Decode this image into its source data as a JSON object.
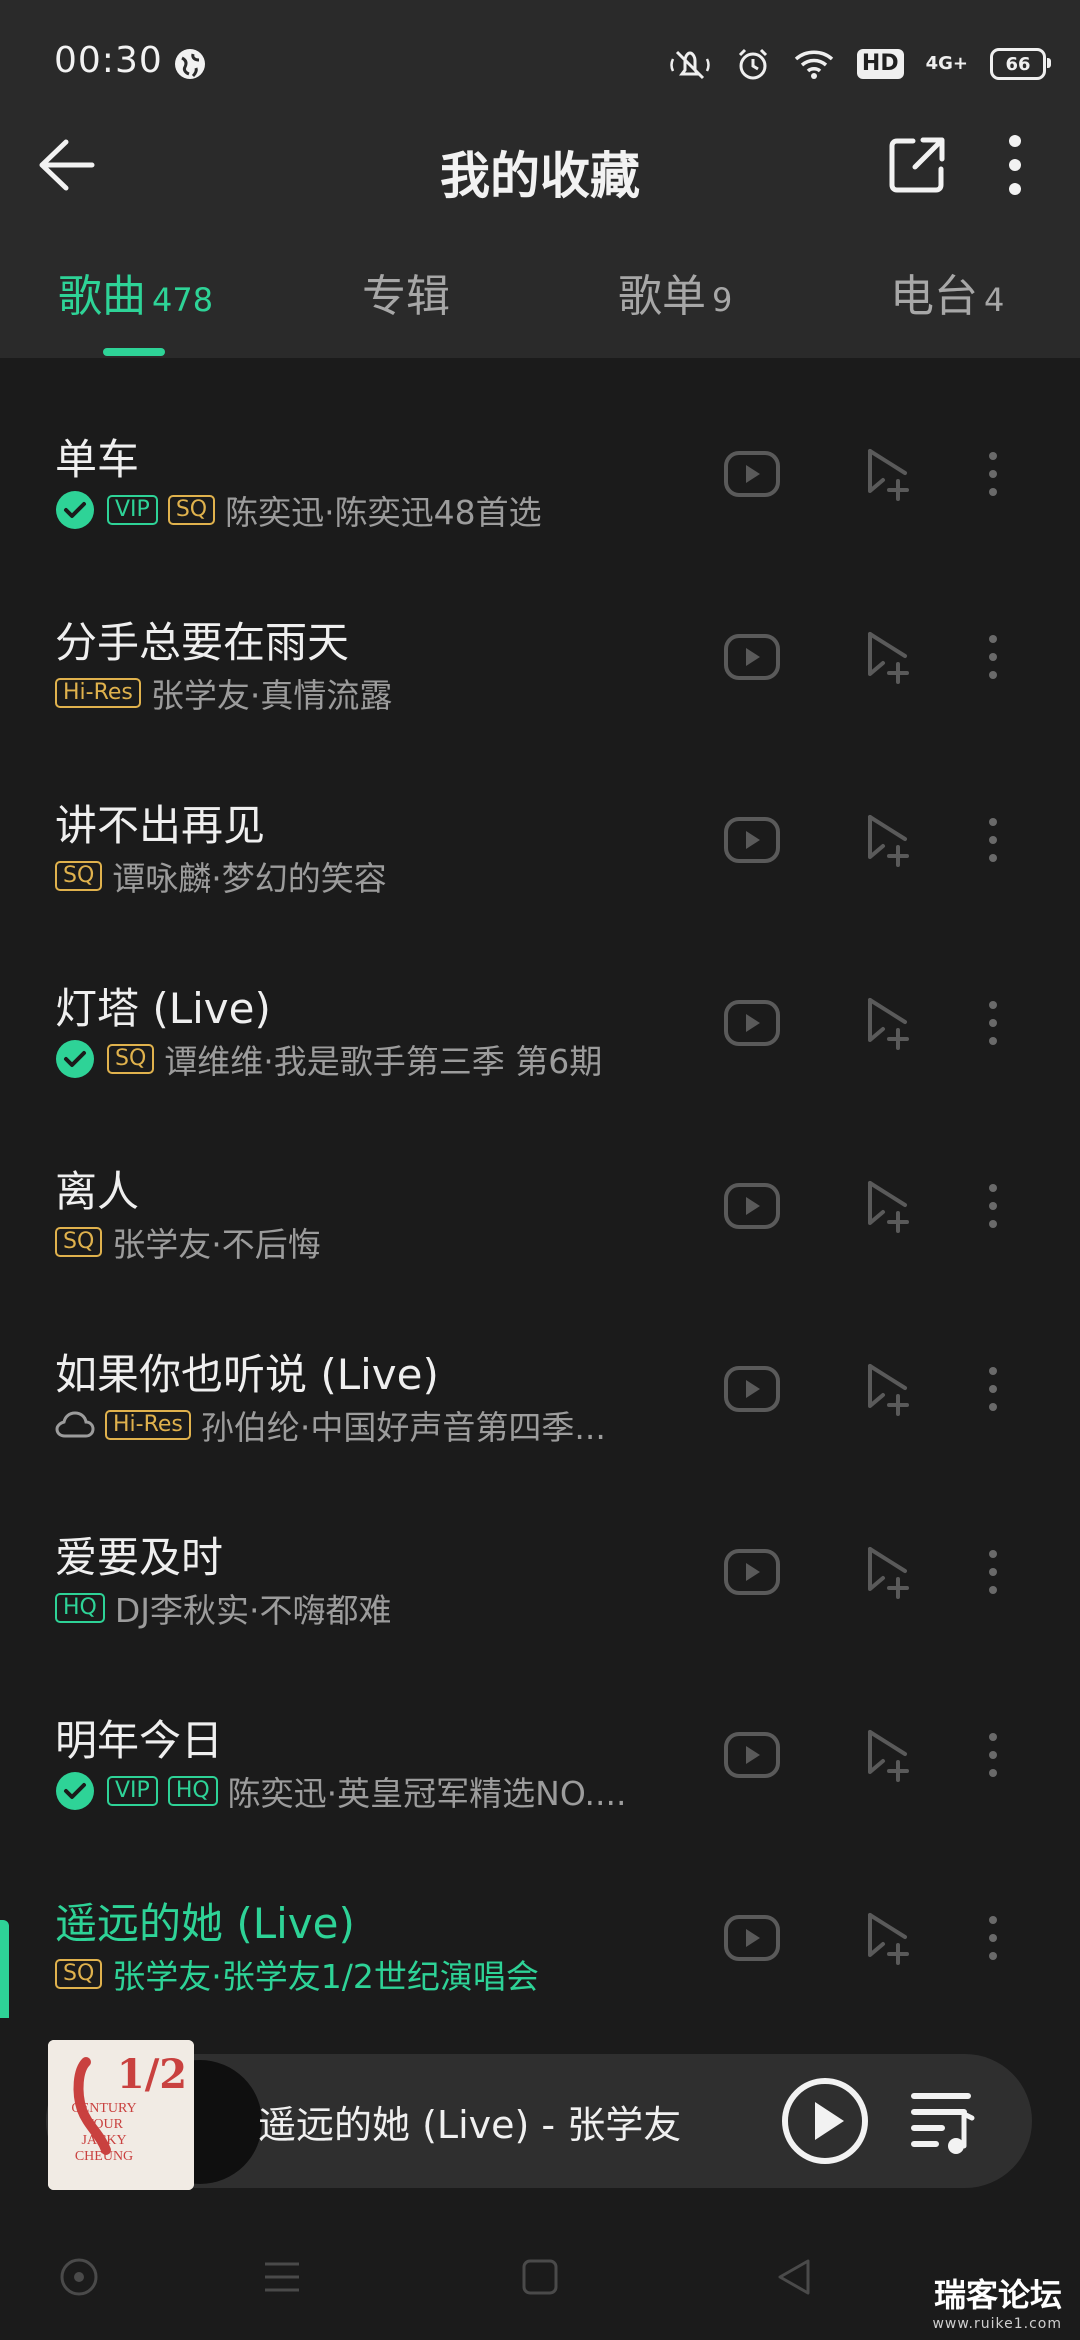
{
  "status_bar": {
    "time": "00:30",
    "hd": "HD",
    "network": "4G+",
    "battery": "66"
  },
  "header": {
    "title": "我的收藏"
  },
  "tabs": [
    {
      "label": "歌曲",
      "count": "478",
      "active": true
    },
    {
      "label": "专辑",
      "count": "",
      "active": false
    },
    {
      "label": "歌单",
      "count": "9",
      "active": false
    },
    {
      "label": "电台",
      "count": "4",
      "active": false
    }
  ],
  "songs": [
    {
      "title": "单车",
      "sub": "陈奕迅·陈奕迅48首选",
      "badges": [
        "VIP",
        "SQ"
      ],
      "downloaded": true
    },
    {
      "title": "分手总要在雨天",
      "sub": "张学友·真情流露",
      "badges": [
        "Hi-Res"
      ]
    },
    {
      "title": "讲不出再见",
      "sub": "谭咏麟·梦幻的笑容",
      "badges": [
        "SQ"
      ]
    },
    {
      "title": "灯塔 (Live)",
      "sub": "谭维维·我是歌手第三季 第6期",
      "badges": [
        "SQ"
      ],
      "downloaded": true
    },
    {
      "title": "离人",
      "sub": "张学友·不后悔",
      "badges": [
        "SQ"
      ]
    },
    {
      "title": "如果你也听说 (Live)",
      "sub": "孙伯纶·中国好声音第四季...",
      "badges": [
        "Hi-Res"
      ],
      "cloud": true
    },
    {
      "title": "爱要及时",
      "sub": "DJ李秋实·不嗨都难",
      "badges": [
        "HQ"
      ]
    },
    {
      "title": "明年今日",
      "sub": "陈奕迅·英皇冠军精选NO....",
      "badges": [
        "VIP",
        "HQ"
      ],
      "downloaded": true
    },
    {
      "title": "遥远的她 (Live)",
      "sub": "张学友·张学友1/2世纪演唱会",
      "badges": [
        "SQ"
      ],
      "playing": true
    }
  ],
  "now_playing": {
    "title": "遥远的她 (Live) - 张学友",
    "album_art_text": {
      "fraction": "1/2",
      "line1": "CENTURY",
      "line2": "TOUR",
      "line3": "JACKY",
      "line4": "CHEUNG"
    }
  },
  "watermark": {
    "text": "瑞客论坛",
    "url": "www.ruike1.com"
  },
  "colors": {
    "accent": "#2ed397",
    "gold_badge": "#e0b24d",
    "background": "#1b1b1b",
    "header_bg": "#2a2a2a"
  },
  "icons": [
    "globe-icon",
    "mute-icon",
    "alarm-icon",
    "wifi-icon",
    "back-arrow-icon",
    "share-icon",
    "more-vertical-icon",
    "mv-icon",
    "add-to-playlist-icon",
    "check-circle-icon",
    "cloud-icon",
    "play-icon",
    "playlist-icon",
    "nav-home-icon",
    "nav-menu-icon",
    "nav-recents-icon",
    "nav-back-icon"
  ]
}
